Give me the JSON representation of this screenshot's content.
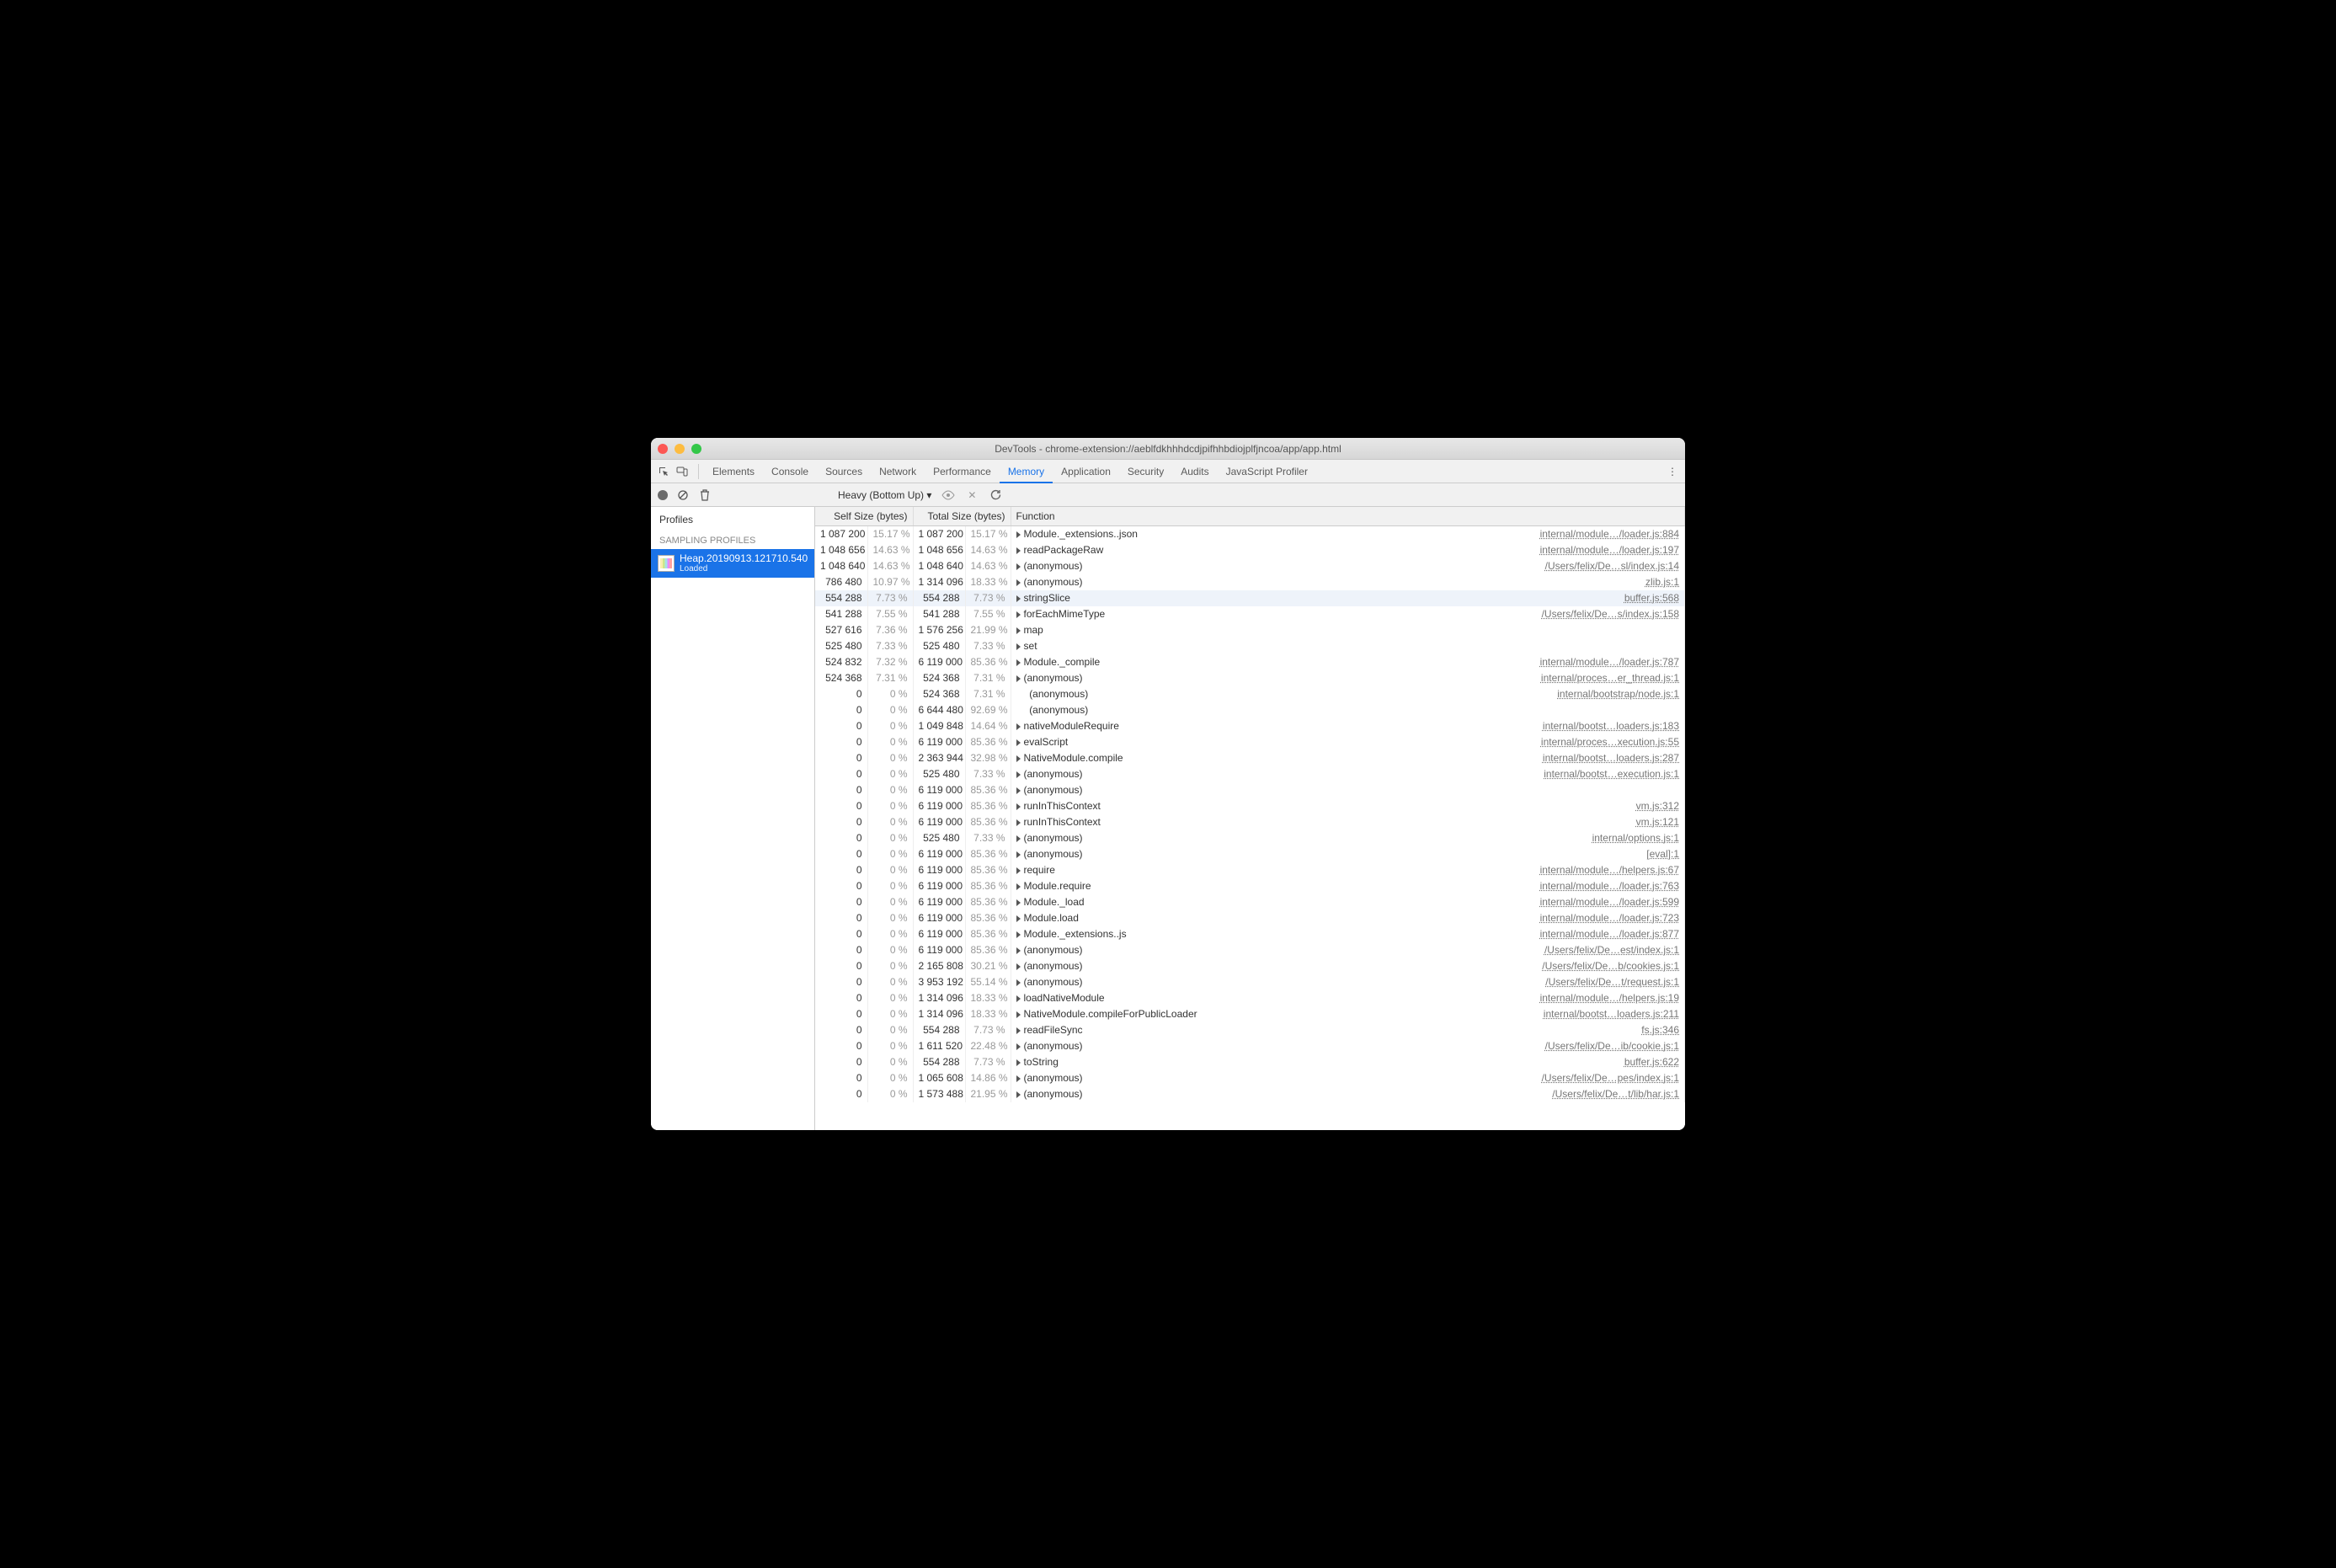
{
  "window": {
    "title": "DevTools - chrome-extension://aeblfdkhhhdcdjpifhhbdiojplfjncoa/app/app.html"
  },
  "tabs": {
    "items": [
      "Elements",
      "Console",
      "Sources",
      "Network",
      "Performance",
      "Memory",
      "Application",
      "Security",
      "Audits",
      "JavaScript Profiler"
    ],
    "active": "Memory"
  },
  "toolbar": {
    "mode": "Heavy (Bottom Up)",
    "dropdown_glyph": "▾"
  },
  "sidebar": {
    "heading": "Profiles",
    "section": "SAMPLING PROFILES",
    "item": {
      "name": "Heap.20190913.121710.540",
      "status": "Loaded"
    }
  },
  "columns": {
    "self": "Self Size (bytes)",
    "total": "Total Size (bytes)",
    "fn": "Function"
  },
  "rows": [
    {
      "ss": "1 087 200",
      "sp": "15.17 %",
      "ts": "1 087 200",
      "tp": "15.17 %",
      "fn": "Module._extensions..json",
      "src": "internal/module…/loader.js:884",
      "tri": true
    },
    {
      "ss": "1 048 656",
      "sp": "14.63 %",
      "ts": "1 048 656",
      "tp": "14.63 %",
      "fn": "readPackageRaw",
      "src": "internal/module…/loader.js:197",
      "tri": true
    },
    {
      "ss": "1 048 640",
      "sp": "14.63 %",
      "ts": "1 048 640",
      "tp": "14.63 %",
      "fn": "(anonymous)",
      "src": "/Users/felix/De…sl/index.js:14",
      "tri": true
    },
    {
      "ss": "786 480",
      "sp": "10.97 %",
      "ts": "1 314 096",
      "tp": "18.33 %",
      "fn": "(anonymous)",
      "src": "zlib.js:1",
      "tri": true
    },
    {
      "ss": "554 288",
      "sp": "7.73 %",
      "ts": "554 288",
      "tp": "7.73 %",
      "fn": "stringSlice",
      "src": "buffer.js:568",
      "tri": true,
      "sel": true
    },
    {
      "ss": "541 288",
      "sp": "7.55 %",
      "ts": "541 288",
      "tp": "7.55 %",
      "fn": "forEachMimeType",
      "src": "/Users/felix/De…s/index.js:158",
      "tri": true
    },
    {
      "ss": "527 616",
      "sp": "7.36 %",
      "ts": "1 576 256",
      "tp": "21.99 %",
      "fn": "map",
      "src": "",
      "tri": true
    },
    {
      "ss": "525 480",
      "sp": "7.33 %",
      "ts": "525 480",
      "tp": "7.33 %",
      "fn": "set",
      "src": "",
      "tri": true
    },
    {
      "ss": "524 832",
      "sp": "7.32 %",
      "ts": "6 119 000",
      "tp": "85.36 %",
      "fn": "Module._compile",
      "src": "internal/module…/loader.js:787",
      "tri": true
    },
    {
      "ss": "524 368",
      "sp": "7.31 %",
      "ts": "524 368",
      "tp": "7.31 %",
      "fn": "(anonymous)",
      "src": "internal/proces…er_thread.js:1",
      "tri": true
    },
    {
      "ss": "0",
      "sp": "0 %",
      "ts": "524 368",
      "tp": "7.31 %",
      "fn": "(anonymous)",
      "src": "internal/bootstrap/node.js:1",
      "tri": false,
      "indent": true
    },
    {
      "ss": "0",
      "sp": "0 %",
      "ts": "6 644 480",
      "tp": "92.69 %",
      "fn": "(anonymous)",
      "src": "",
      "tri": false,
      "indent": true
    },
    {
      "ss": "0",
      "sp": "0 %",
      "ts": "1 049 848",
      "tp": "14.64 %",
      "fn": "nativeModuleRequire",
      "src": "internal/bootst…loaders.js:183",
      "tri": true
    },
    {
      "ss": "0",
      "sp": "0 %",
      "ts": "6 119 000",
      "tp": "85.36 %",
      "fn": "evalScript",
      "src": "internal/proces…xecution.js:55",
      "tri": true
    },
    {
      "ss": "0",
      "sp": "0 %",
      "ts": "2 363 944",
      "tp": "32.98 %",
      "fn": "NativeModule.compile",
      "src": "internal/bootst…loaders.js:287",
      "tri": true
    },
    {
      "ss": "0",
      "sp": "0 %",
      "ts": "525 480",
      "tp": "7.33 %",
      "fn": "(anonymous)",
      "src": "internal/bootst…execution.js:1",
      "tri": true
    },
    {
      "ss": "0",
      "sp": "0 %",
      "ts": "6 119 000",
      "tp": "85.36 %",
      "fn": "(anonymous)",
      "src": "",
      "tri": true
    },
    {
      "ss": "0",
      "sp": "0 %",
      "ts": "6 119 000",
      "tp": "85.36 %",
      "fn": "runInThisContext",
      "src": "vm.js:312",
      "tri": true
    },
    {
      "ss": "0",
      "sp": "0 %",
      "ts": "6 119 000",
      "tp": "85.36 %",
      "fn": "runInThisContext",
      "src": "vm.js:121",
      "tri": true
    },
    {
      "ss": "0",
      "sp": "0 %",
      "ts": "525 480",
      "tp": "7.33 %",
      "fn": "(anonymous)",
      "src": "internal/options.js:1",
      "tri": true
    },
    {
      "ss": "0",
      "sp": "0 %",
      "ts": "6 119 000",
      "tp": "85.36 %",
      "fn": "(anonymous)",
      "src": "[eval]:1",
      "tri": true
    },
    {
      "ss": "0",
      "sp": "0 %",
      "ts": "6 119 000",
      "tp": "85.36 %",
      "fn": "require",
      "src": "internal/module…/helpers.js:67",
      "tri": true
    },
    {
      "ss": "0",
      "sp": "0 %",
      "ts": "6 119 000",
      "tp": "85.36 %",
      "fn": "Module.require",
      "src": "internal/module…/loader.js:763",
      "tri": true
    },
    {
      "ss": "0",
      "sp": "0 %",
      "ts": "6 119 000",
      "tp": "85.36 %",
      "fn": "Module._load",
      "src": "internal/module…/loader.js:599",
      "tri": true
    },
    {
      "ss": "0",
      "sp": "0 %",
      "ts": "6 119 000",
      "tp": "85.36 %",
      "fn": "Module.load",
      "src": "internal/module…/loader.js:723",
      "tri": true
    },
    {
      "ss": "0",
      "sp": "0 %",
      "ts": "6 119 000",
      "tp": "85.36 %",
      "fn": "Module._extensions..js",
      "src": "internal/module…/loader.js:877",
      "tri": true
    },
    {
      "ss": "0",
      "sp": "0 %",
      "ts": "6 119 000",
      "tp": "85.36 %",
      "fn": "(anonymous)",
      "src": "/Users/felix/De…est/index.js:1",
      "tri": true
    },
    {
      "ss": "0",
      "sp": "0 %",
      "ts": "2 165 808",
      "tp": "30.21 %",
      "fn": "(anonymous)",
      "src": "/Users/felix/De…b/cookies.js:1",
      "tri": true
    },
    {
      "ss": "0",
      "sp": "0 %",
      "ts": "3 953 192",
      "tp": "55.14 %",
      "fn": "(anonymous)",
      "src": "/Users/felix/De…t/request.js:1",
      "tri": true
    },
    {
      "ss": "0",
      "sp": "0 %",
      "ts": "1 314 096",
      "tp": "18.33 %",
      "fn": "loadNativeModule",
      "src": "internal/module…/helpers.js:19",
      "tri": true
    },
    {
      "ss": "0",
      "sp": "0 %",
      "ts": "1 314 096",
      "tp": "18.33 %",
      "fn": "NativeModule.compileForPublicLoader",
      "src": "internal/bootst…loaders.js:211",
      "tri": true
    },
    {
      "ss": "0",
      "sp": "0 %",
      "ts": "554 288",
      "tp": "7.73 %",
      "fn": "readFileSync",
      "src": "fs.js:346",
      "tri": true
    },
    {
      "ss": "0",
      "sp": "0 %",
      "ts": "1 611 520",
      "tp": "22.48 %",
      "fn": "(anonymous)",
      "src": "/Users/felix/De…ib/cookie.js:1",
      "tri": true
    },
    {
      "ss": "0",
      "sp": "0 %",
      "ts": "554 288",
      "tp": "7.73 %",
      "fn": "toString",
      "src": "buffer.js:622",
      "tri": true
    },
    {
      "ss": "0",
      "sp": "0 %",
      "ts": "1 065 608",
      "tp": "14.86 %",
      "fn": "(anonymous)",
      "src": "/Users/felix/De…pes/index.js:1",
      "tri": true
    },
    {
      "ss": "0",
      "sp": "0 %",
      "ts": "1 573 488",
      "tp": "21.95 %",
      "fn": "(anonymous)",
      "src": "/Users/felix/De…t/lib/har.js:1",
      "tri": true
    }
  ]
}
